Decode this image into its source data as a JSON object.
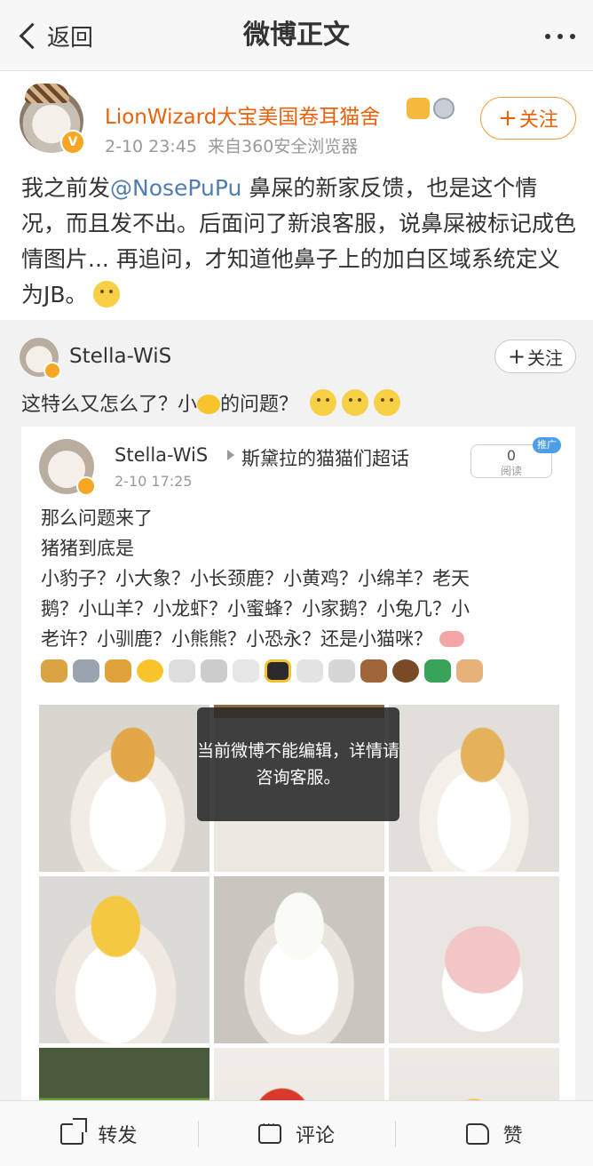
{
  "nav": {
    "back_label": "返回",
    "title": "微博正文"
  },
  "post": {
    "author": "LionWizard大宝美国卷耳猫舍",
    "time": "2-10 23:45",
    "source": "来自360安全浏览器",
    "follow_label": "关注",
    "text_before_mention": "我之前发",
    "mention": "@NosePuPu",
    "text_after_mention": " 鼻屎的新家反馈，也是这个情况，而且发不出。后面问了新浪客服，说鼻屎被标记成色情图片... 再追问，才知道他鼻子上的加白区域系统定义为JB。"
  },
  "repost": {
    "author": "Stella-WiS",
    "follow_label": "关注",
    "text_before_icon": "这特么又怎么了？小",
    "text_after_icon": "的问题？",
    "shot": {
      "author": "Stella-WiS",
      "topic": "斯黛拉的猫猫们超话",
      "time": "2-10 17:25",
      "reads_count": "0",
      "reads_label": "阅读",
      "promo_badge": "推广",
      "lines": [
        "那么问题来了",
        "猪猪到底是",
        "小豹子？小大象？小长颈鹿？小黄鸡？小绵羊？老天",
        "鹅？小山羊？小龙虾？小蜜蜂？小家鹅？小兔几？小",
        "老许？小驯鹿？小熊熊？小恐永？还是小猫咪？"
      ],
      "toast": "当前微博不能编辑，详情请咨询客服。"
    }
  },
  "actions": {
    "repost": "转发",
    "comment": "评论",
    "like": "赞"
  },
  "colors": {
    "accent_orange": "#e8620c",
    "mention_blue": "#507daf"
  }
}
